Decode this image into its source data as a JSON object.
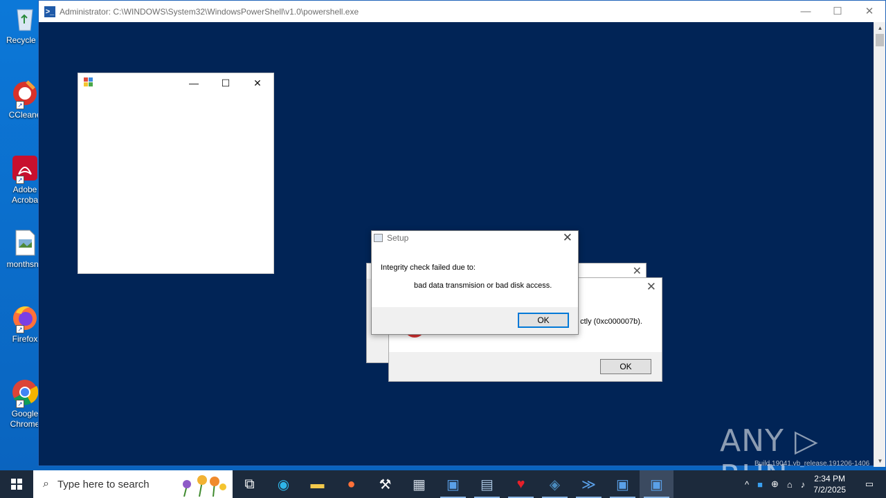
{
  "desktop": {
    "icons": [
      {
        "label": "Recycle B"
      },
      {
        "label": "CCleane"
      },
      {
        "label": "Adobe\nAcroba"
      },
      {
        "label": "monthsno"
      },
      {
        "label": "Firefox"
      },
      {
        "label": "Google\nChrome"
      }
    ],
    "watermark": "ANY ▷ RUN",
    "build_text": "Build 19041.vb_release.191206-1406"
  },
  "powershell_window": {
    "title": "Administrator: C:\\WINDOWS\\System32\\WindowsPowerShell\\v1.0\\powershell.exe",
    "icon": ">_",
    "controls": {
      "minimize": "—",
      "maximize": "☐",
      "close": "✕"
    },
    "background": "#012456"
  },
  "form_window": {
    "controls": {
      "minimize": "—",
      "maximize": "☐",
      "close": "✕"
    }
  },
  "back_dialog": {
    "close": "✕"
  },
  "error_dialog": {
    "close": "✕",
    "message": "ctly (0xc000007b).",
    "ok_label": "OK"
  },
  "setup_dialog": {
    "title": "Setup",
    "close": "✕",
    "line1": "Integrity check failed due to:",
    "line2": "bad data transmision or bad disk access.",
    "ok_label": "OK"
  },
  "taskbar": {
    "search_placeholder": "Type here to search",
    "search_icon": "⌕",
    "apps": [
      {
        "name": "task-view-icon",
        "glyph": "⧉"
      },
      {
        "name": "edge-icon",
        "glyph": "◉"
      },
      {
        "name": "file-explorer-icon",
        "glyph": "▬"
      },
      {
        "name": "firefox-icon",
        "glyph": "●"
      },
      {
        "name": "tool-icon",
        "glyph": "⚒"
      },
      {
        "name": "network-icon",
        "glyph": "▦"
      },
      {
        "name": "window-app-icon",
        "glyph": "▣"
      },
      {
        "name": "installer-icon",
        "glyph": "▤"
      },
      {
        "name": "heart-app-icon",
        "glyph": "♥"
      },
      {
        "name": "python-icon",
        "glyph": "◈"
      },
      {
        "name": "powershell-icon",
        "glyph": "≫"
      },
      {
        "name": "setup-app-icon",
        "glyph": "▣"
      },
      {
        "name": "form-app-icon",
        "glyph": "▣"
      }
    ],
    "tray": {
      "chevron": "^",
      "time": "2:34 PM",
      "date": "7/2/2025"
    }
  }
}
